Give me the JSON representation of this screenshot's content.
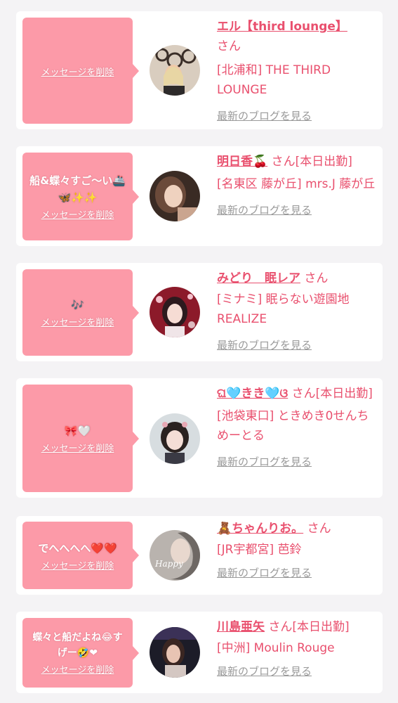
{
  "delete_label": "メッセージを削除",
  "blog_label": "最新のブログを見る",
  "entries": [
    {
      "bubble_text": "",
      "name": "エル【third lounge】",
      "suffix": "さん",
      "area_shop": "[北浦和] THE THIRD LOUNGE"
    },
    {
      "bubble_text": "船&蝶々すご〜い🚢🦋✨✨",
      "name": "明日香🍒",
      "suffix": "さん[本日出勤]",
      "area_shop": "[名東区 藤が丘] mrs.J 藤が丘"
    },
    {
      "bubble_text": "🎶",
      "name": "みどり　眠レア",
      "suffix": "さん",
      "area_shop": "[ミナミ] 眠らない遊園地REALIZE"
    },
    {
      "bubble_text": "🎀🤍",
      "name": "ଘ🩵きき🩵ଓ",
      "suffix": "さん[本日出勤]",
      "area_shop": "[池袋東口] ときめき0せんちめーとる"
    },
    {
      "bubble_text": "でへへへへ❤️❤️",
      "name": "🧸ちゃんりお。",
      "suffix": "さん",
      "area_shop": "[JR宇都宮] 芭鈴"
    },
    {
      "bubble_text": "蝶々と船だよね😂すげー🤣❤",
      "name": "川島亜矢",
      "suffix": "さん[本日出勤]",
      "area_shop": "[中洲] Moulin Rouge"
    }
  ]
}
